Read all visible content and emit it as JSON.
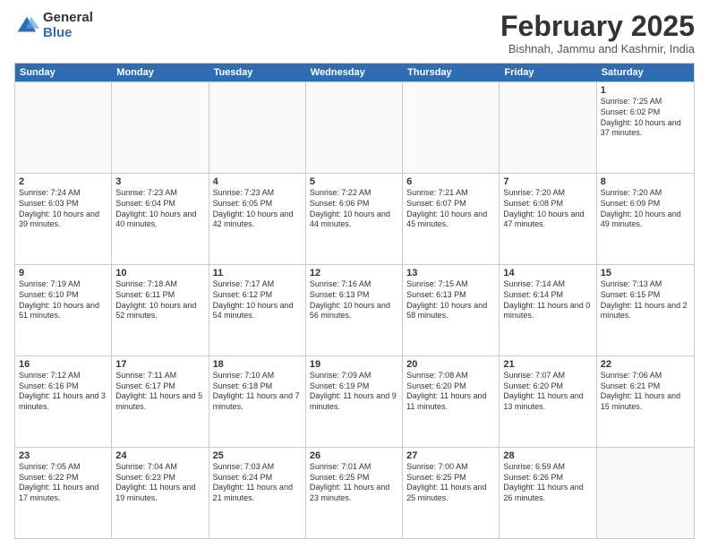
{
  "logo": {
    "general": "General",
    "blue": "Blue"
  },
  "header": {
    "month": "February 2025",
    "location": "Bishnah, Jammu and Kashmir, India"
  },
  "days": [
    "Sunday",
    "Monday",
    "Tuesday",
    "Wednesday",
    "Thursday",
    "Friday",
    "Saturday"
  ],
  "rows": [
    [
      {
        "day": "",
        "empty": true
      },
      {
        "day": "",
        "empty": true
      },
      {
        "day": "",
        "empty": true
      },
      {
        "day": "",
        "empty": true
      },
      {
        "day": "",
        "empty": true
      },
      {
        "day": "",
        "empty": true
      },
      {
        "day": "1",
        "text": "Sunrise: 7:25 AM\nSunset: 6:02 PM\nDaylight: 10 hours and 37 minutes."
      }
    ],
    [
      {
        "day": "2",
        "text": "Sunrise: 7:24 AM\nSunset: 6:03 PM\nDaylight: 10 hours and 39 minutes."
      },
      {
        "day": "3",
        "text": "Sunrise: 7:23 AM\nSunset: 6:04 PM\nDaylight: 10 hours and 40 minutes."
      },
      {
        "day": "4",
        "text": "Sunrise: 7:23 AM\nSunset: 6:05 PM\nDaylight: 10 hours and 42 minutes."
      },
      {
        "day": "5",
        "text": "Sunrise: 7:22 AM\nSunset: 6:06 PM\nDaylight: 10 hours and 44 minutes."
      },
      {
        "day": "6",
        "text": "Sunrise: 7:21 AM\nSunset: 6:07 PM\nDaylight: 10 hours and 45 minutes."
      },
      {
        "day": "7",
        "text": "Sunrise: 7:20 AM\nSunset: 6:08 PM\nDaylight: 10 hours and 47 minutes."
      },
      {
        "day": "8",
        "text": "Sunrise: 7:20 AM\nSunset: 6:09 PM\nDaylight: 10 hours and 49 minutes."
      }
    ],
    [
      {
        "day": "9",
        "text": "Sunrise: 7:19 AM\nSunset: 6:10 PM\nDaylight: 10 hours and 51 minutes."
      },
      {
        "day": "10",
        "text": "Sunrise: 7:18 AM\nSunset: 6:11 PM\nDaylight: 10 hours and 52 minutes."
      },
      {
        "day": "11",
        "text": "Sunrise: 7:17 AM\nSunset: 6:12 PM\nDaylight: 10 hours and 54 minutes."
      },
      {
        "day": "12",
        "text": "Sunrise: 7:16 AM\nSunset: 6:13 PM\nDaylight: 10 hours and 56 minutes."
      },
      {
        "day": "13",
        "text": "Sunrise: 7:15 AM\nSunset: 6:13 PM\nDaylight: 10 hours and 58 minutes."
      },
      {
        "day": "14",
        "text": "Sunrise: 7:14 AM\nSunset: 6:14 PM\nDaylight: 11 hours and 0 minutes."
      },
      {
        "day": "15",
        "text": "Sunrise: 7:13 AM\nSunset: 6:15 PM\nDaylight: 11 hours and 2 minutes."
      }
    ],
    [
      {
        "day": "16",
        "text": "Sunrise: 7:12 AM\nSunset: 6:16 PM\nDaylight: 11 hours and 3 minutes."
      },
      {
        "day": "17",
        "text": "Sunrise: 7:11 AM\nSunset: 6:17 PM\nDaylight: 11 hours and 5 minutes."
      },
      {
        "day": "18",
        "text": "Sunrise: 7:10 AM\nSunset: 6:18 PM\nDaylight: 11 hours and 7 minutes."
      },
      {
        "day": "19",
        "text": "Sunrise: 7:09 AM\nSunset: 6:19 PM\nDaylight: 11 hours and 9 minutes."
      },
      {
        "day": "20",
        "text": "Sunrise: 7:08 AM\nSunset: 6:20 PM\nDaylight: 11 hours and 11 minutes."
      },
      {
        "day": "21",
        "text": "Sunrise: 7:07 AM\nSunset: 6:20 PM\nDaylight: 11 hours and 13 minutes."
      },
      {
        "day": "22",
        "text": "Sunrise: 7:06 AM\nSunset: 6:21 PM\nDaylight: 11 hours and 15 minutes."
      }
    ],
    [
      {
        "day": "23",
        "text": "Sunrise: 7:05 AM\nSunset: 6:22 PM\nDaylight: 11 hours and 17 minutes."
      },
      {
        "day": "24",
        "text": "Sunrise: 7:04 AM\nSunset: 6:23 PM\nDaylight: 11 hours and 19 minutes."
      },
      {
        "day": "25",
        "text": "Sunrise: 7:03 AM\nSunset: 6:24 PM\nDaylight: 11 hours and 21 minutes."
      },
      {
        "day": "26",
        "text": "Sunrise: 7:01 AM\nSunset: 6:25 PM\nDaylight: 11 hours and 23 minutes."
      },
      {
        "day": "27",
        "text": "Sunrise: 7:00 AM\nSunset: 6:25 PM\nDaylight: 11 hours and 25 minutes."
      },
      {
        "day": "28",
        "text": "Sunrise: 6:59 AM\nSunset: 6:26 PM\nDaylight: 11 hours and 26 minutes."
      },
      {
        "day": "",
        "empty": true
      }
    ]
  ]
}
